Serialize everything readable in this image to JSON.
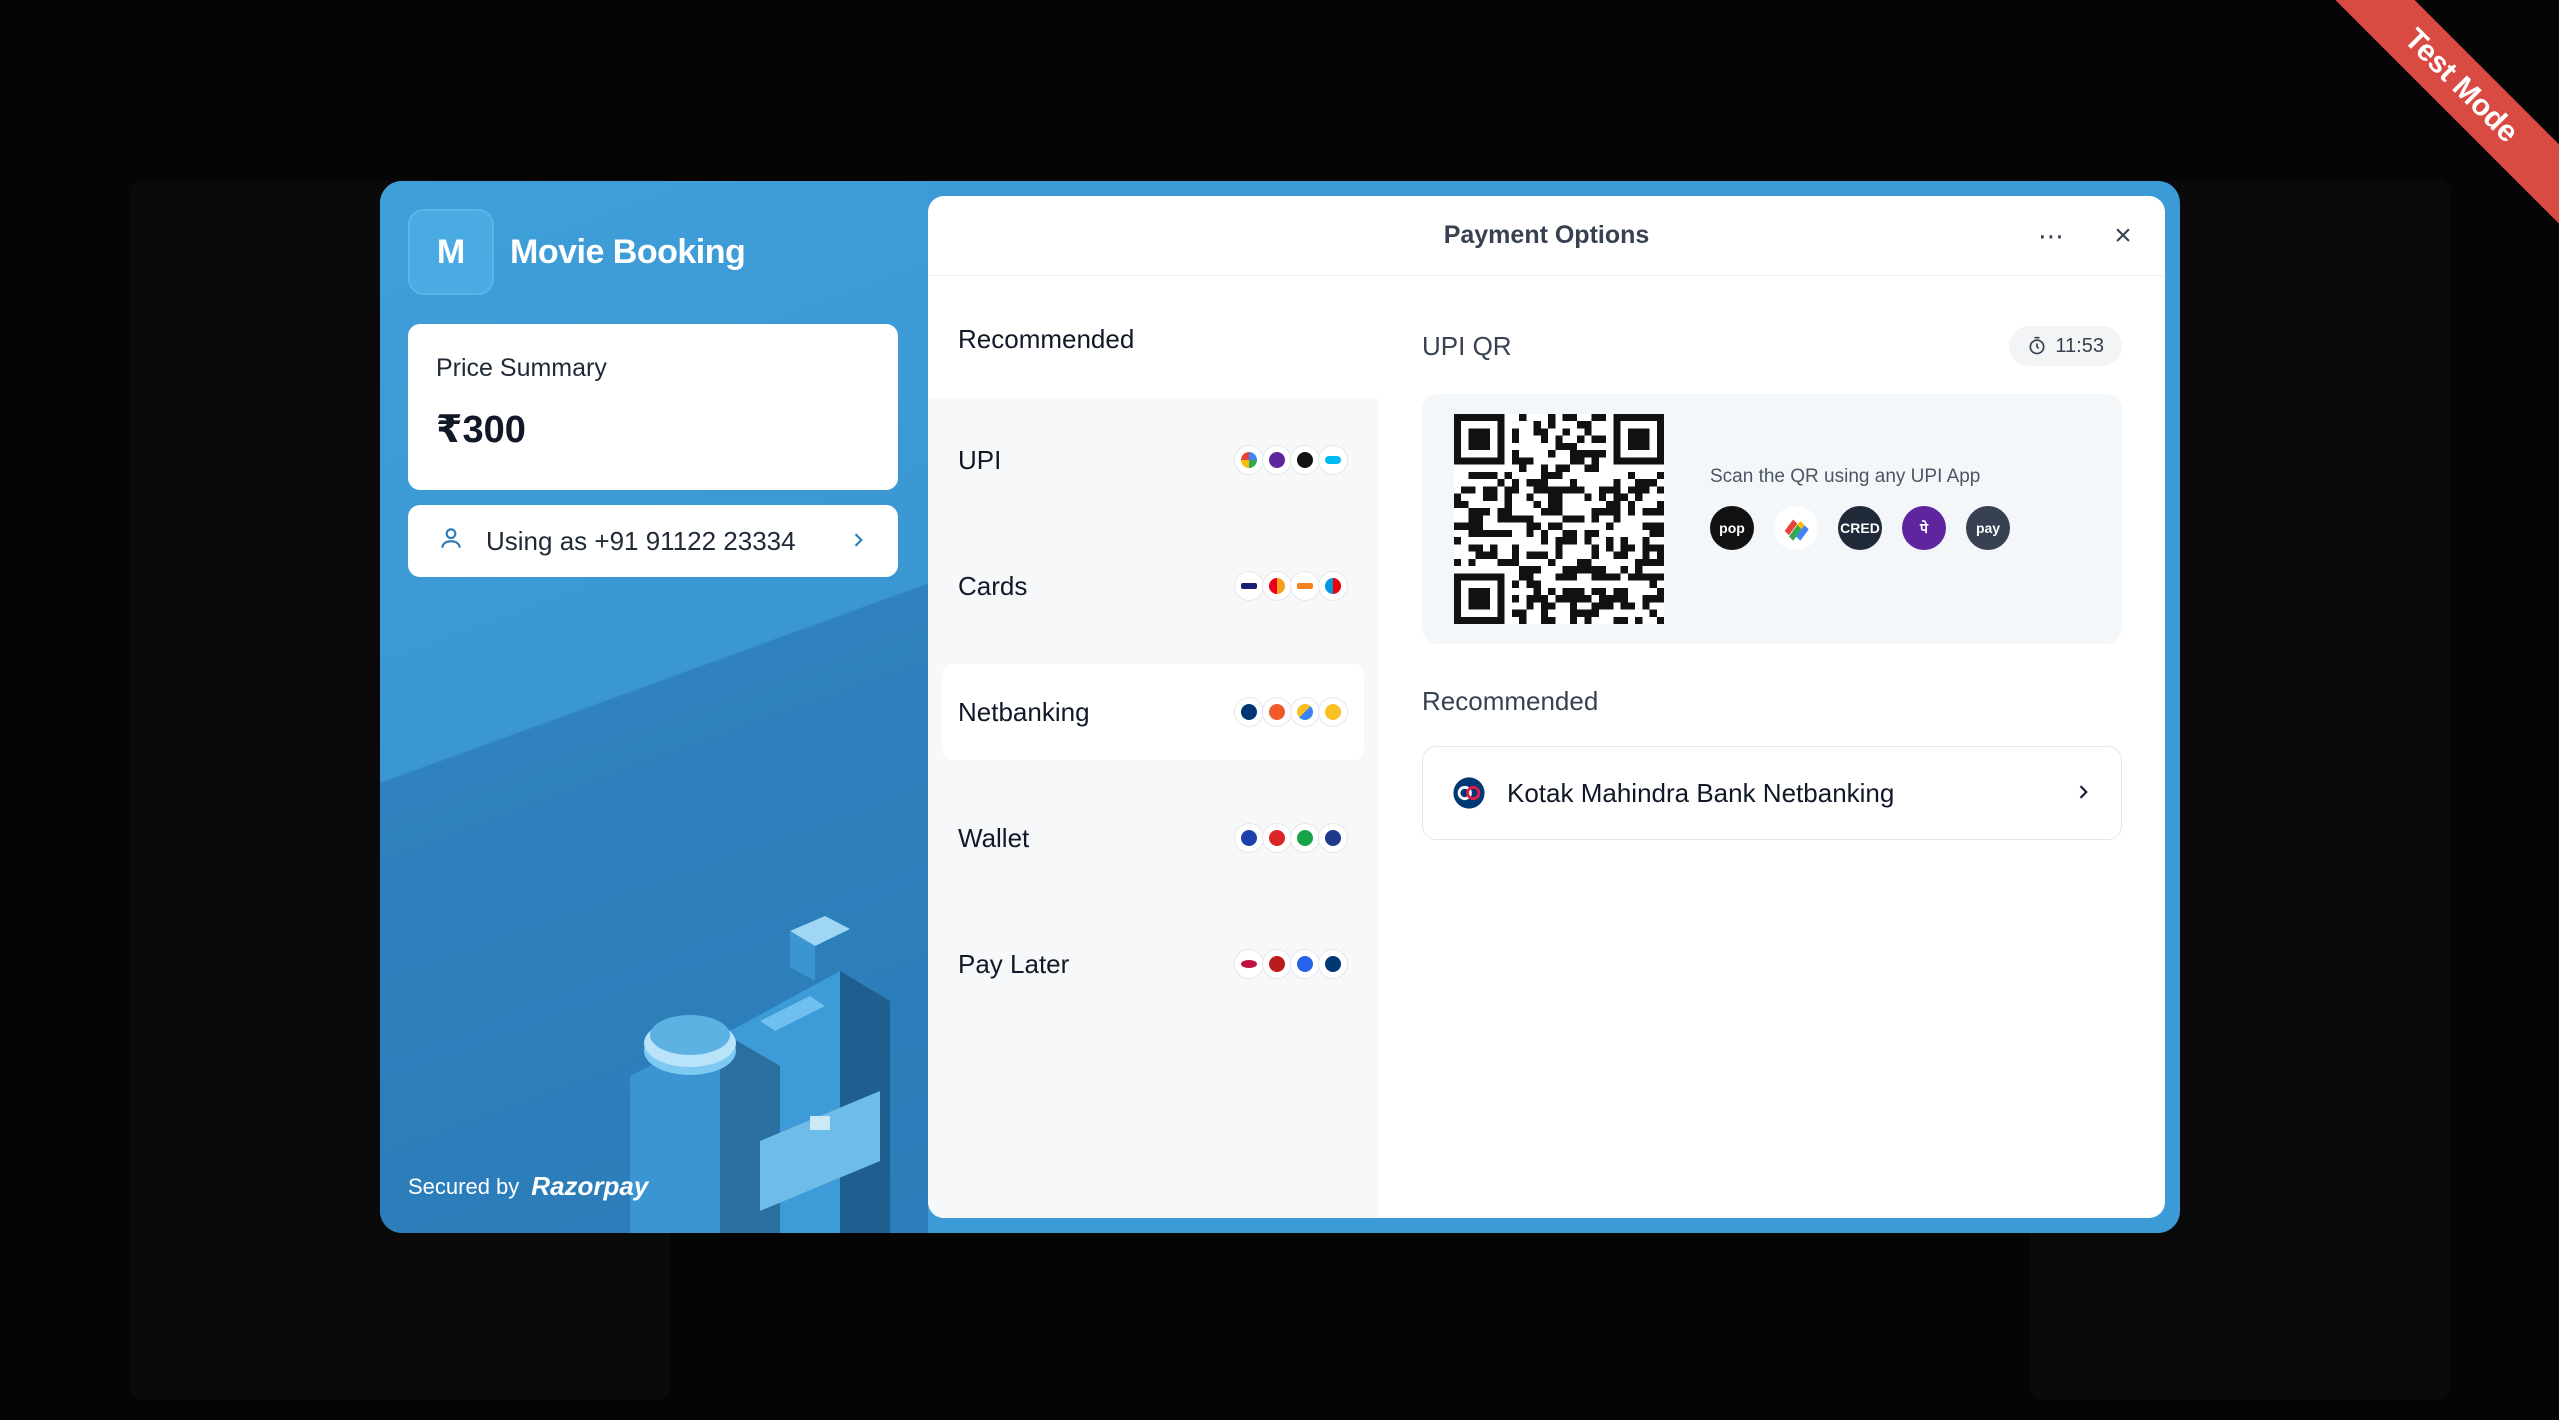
{
  "ribbon": {
    "label": "Test Mode"
  },
  "brand": {
    "initial": "M",
    "name": "Movie Booking"
  },
  "price_summary": {
    "label": "Price Summary",
    "amount": "₹300"
  },
  "user": {
    "label": "Using as +91 91122 23334"
  },
  "secured": {
    "prefix": "Secured by",
    "provider": "Razorpay"
  },
  "header": {
    "title": "Payment Options"
  },
  "methods": {
    "section_title": "Recommended",
    "items": [
      {
        "label": "UPI"
      },
      {
        "label": "Cards"
      },
      {
        "label": "Netbanking"
      },
      {
        "label": "Wallet"
      },
      {
        "label": "Pay Later"
      }
    ]
  },
  "upi_qr": {
    "title": "UPI QR",
    "timer": "11:53",
    "scan_text": "Scan the QR using any UPI App",
    "apps": [
      {
        "name": "pop",
        "label": "pop",
        "color": "#111111"
      },
      {
        "name": "google-pay",
        "label": "",
        "color": "#ffffff"
      },
      {
        "name": "cred",
        "label": "CRED",
        "color": "#1f2937"
      },
      {
        "name": "phonepe",
        "label": "पे",
        "color": "#5f259f"
      },
      {
        "name": "amazon-pay",
        "label": "pay",
        "color": "#374151"
      }
    ]
  },
  "recommended": {
    "title": "Recommended",
    "bank": {
      "label": "Kotak Mahindra Bank Netbanking"
    }
  },
  "colors": {
    "modal_blue": "#3c9ad6",
    "ribbon_red": "#d94a43",
    "text_dark": "#111827"
  }
}
